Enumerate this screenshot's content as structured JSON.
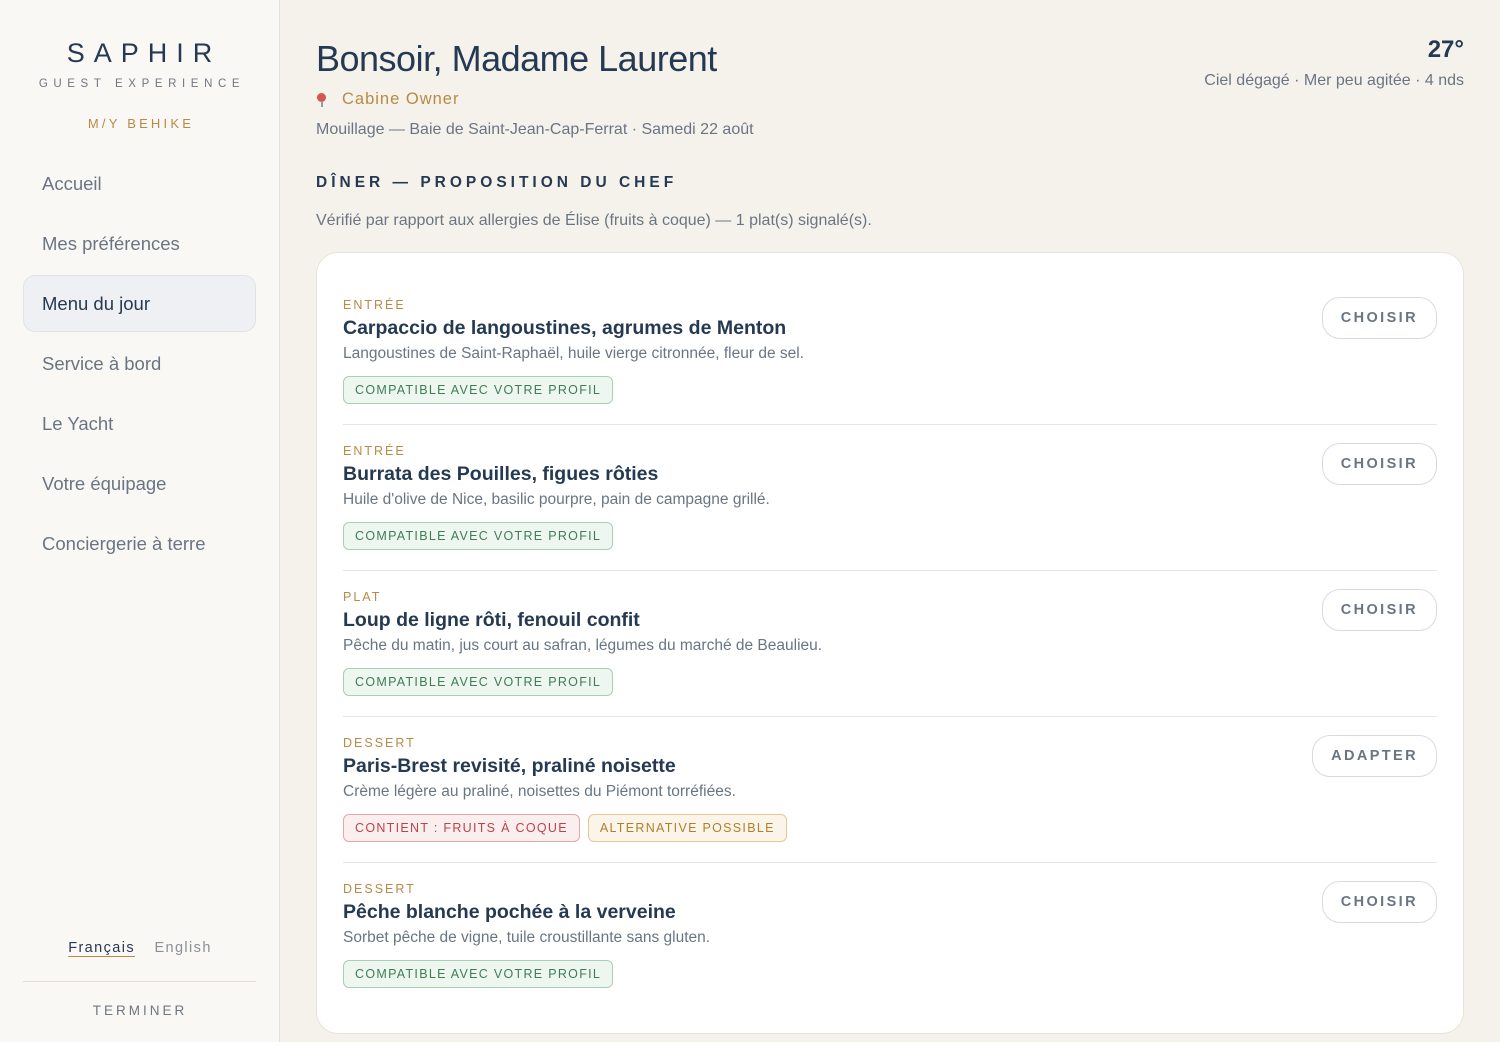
{
  "brand": {
    "name": "SAPHIR",
    "subtitle": "GUEST EXPERIENCE",
    "yacht": "M/Y BEHIKE"
  },
  "sidebar": {
    "items": [
      {
        "label": "Accueil",
        "active": false
      },
      {
        "label": "Mes préférences",
        "active": false
      },
      {
        "label": "Menu du jour",
        "active": true
      },
      {
        "label": "Service à bord",
        "active": false
      },
      {
        "label": "Le Yacht",
        "active": false
      },
      {
        "label": "Votre équipage",
        "active": false
      },
      {
        "label": "Conciergerie à terre",
        "active": false
      }
    ],
    "languages": {
      "current": "Français",
      "other": "English"
    },
    "finish_label": "TERMINER"
  },
  "header": {
    "greeting": "Bonsoir, Madame Laurent",
    "role_icon": "pin-icon",
    "role": "Cabine Owner",
    "location": "Mouillage — Baie de Saint-Jean-Cap-Ferrat · Samedi 22 août",
    "weather": {
      "temperature": "27°",
      "conditions": "Ciel dégagé · Mer peu agitée · 4 nds"
    }
  },
  "menu": {
    "section_title": "DÎNER — PROPOSITION DU CHEF",
    "allergy_note": "Vérifié par rapport aux allergies de Élise (fruits à coque) — 1 plat(s) signalé(s).",
    "dishes": [
      {
        "course": "ENTRÉE",
        "name": "Carpaccio de langoustines, agrumes de Menton",
        "description": "Langoustines de Saint-Raphaël, huile vierge citronnée, fleur de sel.",
        "tags": [
          {
            "label": "COMPATIBLE AVEC VOTRE PROFIL",
            "kind": "ok"
          }
        ],
        "action": "CHOISIR"
      },
      {
        "course": "ENTRÉE",
        "name": "Burrata des Pouilles, figues rôties",
        "description": "Huile d'olive de Nice, basilic pourpre, pain de campagne grillé.",
        "tags": [
          {
            "label": "COMPATIBLE AVEC VOTRE PROFIL",
            "kind": "ok"
          }
        ],
        "action": "CHOISIR"
      },
      {
        "course": "PLAT",
        "name": "Loup de ligne rôti, fenouil confit",
        "description": "Pêche du matin, jus court au safran, légumes du marché de Beaulieu.",
        "tags": [
          {
            "label": "COMPATIBLE AVEC VOTRE PROFIL",
            "kind": "ok"
          }
        ],
        "action": "CHOISIR"
      },
      {
        "course": "DESSERT",
        "name": "Paris-Brest revisité, praliné noisette",
        "description": "Crème légère au praliné, noisettes du Piémont torréfiées.",
        "tags": [
          {
            "label": "CONTIENT : FRUITS À COQUE",
            "kind": "warn"
          },
          {
            "label": "ALTERNATIVE POSSIBLE",
            "kind": "alt"
          }
        ],
        "action": "ADAPTER"
      },
      {
        "course": "DESSERT",
        "name": "Pêche blanche pochée à la verveine",
        "description": "Sorbet pêche de vigne, tuile croustillante sans gluten.",
        "tags": [
          {
            "label": "COMPATIBLE AVEC VOTRE PROFIL",
            "kind": "ok"
          }
        ],
        "action": "CHOISIR"
      }
    ]
  },
  "colors": {
    "navy": "#253a52",
    "gold": "#b88a45",
    "background": "#f5f2ec",
    "ok": "#3f7d55",
    "warn": "#b8454a"
  }
}
